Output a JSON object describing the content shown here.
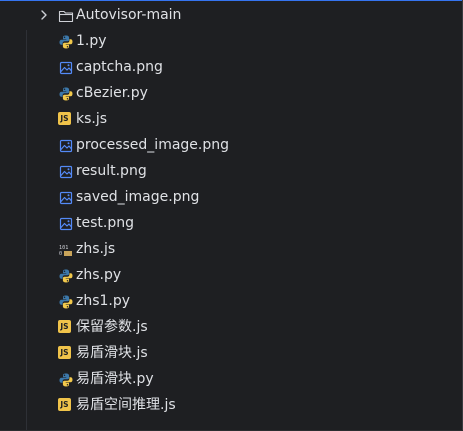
{
  "project_tree": {
    "folder": {
      "name": "Autovisor-main",
      "expanded": false
    },
    "files": [
      {
        "name": "1.py",
        "icon": "python-file-icon"
      },
      {
        "name": "captcha.png",
        "icon": "image-file-icon"
      },
      {
        "name": "cBezier.py",
        "icon": "python-file-icon"
      },
      {
        "name": "ks.js",
        "icon": "javascript-file-icon"
      },
      {
        "name": "processed_image.png",
        "icon": "image-file-icon"
      },
      {
        "name": "result.png",
        "icon": "image-file-icon"
      },
      {
        "name": "saved_image.png",
        "icon": "image-file-icon"
      },
      {
        "name": "test.png",
        "icon": "image-file-icon"
      },
      {
        "name": "zhs.js",
        "icon": "binary-file-icon"
      },
      {
        "name": "zhs.py",
        "icon": "python-file-icon"
      },
      {
        "name": "zhs1.py",
        "icon": "python-file-icon"
      },
      {
        "name": "保留参数.js",
        "icon": "javascript-file-icon"
      },
      {
        "name": "易盾滑块.js",
        "icon": "javascript-file-icon"
      },
      {
        "name": "易盾滑块.py",
        "icon": "python-file-icon"
      },
      {
        "name": "易盾空间推理.js",
        "icon": "javascript-file-icon"
      }
    ],
    "js_badge_text": "JS",
    "binary_badge_text": "101"
  },
  "colors": {
    "background": "#1e1f22",
    "text": "#dfe1e5",
    "python_blue": "#3c78aa",
    "python_yellow": "#f2c94c",
    "image_icon": "#548af7",
    "js_badge": "#f0c34a",
    "folder_icon": "#ced0d6"
  }
}
